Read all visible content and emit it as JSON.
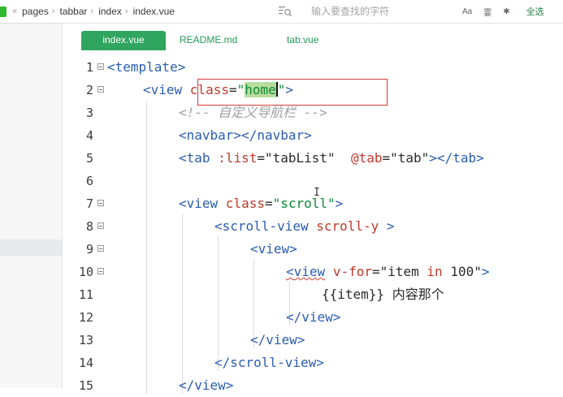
{
  "breadcrumb": {
    "items": [
      "pages",
      "tabbar",
      "index",
      "index.vue"
    ]
  },
  "search": {
    "placeholder": "输入要查找的字符"
  },
  "toolbar": {
    "case_label": "Aa",
    "word_label": "霎",
    "regex_label": "✱",
    "select_all_label": "全选"
  },
  "tabs": [
    {
      "label": "index.vue",
      "active": true
    },
    {
      "label": "README.md",
      "active": false
    },
    {
      "label": "tab.vue",
      "active": false
    }
  ],
  "colors": {
    "accent": "#2fa560",
    "tag": "#2a5db0",
    "attribute": "#c0392b",
    "string": "#0b8a37",
    "comment": "#a0a0a0",
    "highlight": "#d63a3a"
  },
  "code": {
    "line_numbers": [
      "1",
      "2",
      "3",
      "4",
      "5",
      "6",
      "7",
      "8",
      "9",
      "10",
      "11",
      "12",
      "13",
      "14",
      "15"
    ],
    "l1": {
      "tag": "<template>"
    },
    "l2": {
      "open": "<view ",
      "attr": "class",
      "eq": "=",
      "q1": "\"",
      "val": "home",
      "q2": "\"",
      "close": ">"
    },
    "l3": {
      "comment": "<!-- 自定义导航栏 -->"
    },
    "l4": {
      "tag": "<navbar></navbar>"
    },
    "l5": {
      "open": "<tab ",
      "a1": ":list",
      "eq1": "=",
      "v1": "\"tabList\"",
      "sp": "  ",
      "a2": "@tab",
      "eq2": "=",
      "v2": "\"tab\"",
      "close": "></tab>"
    },
    "l7": {
      "open": "<view ",
      "attr": "class",
      "eq": "=",
      "val": "\"scroll\"",
      "close": ">"
    },
    "l8": {
      "open": "<scroll-view ",
      "attr": "scroll-y",
      "close": " >"
    },
    "l9": {
      "tag": "<view>"
    },
    "l10": {
      "lt": "<",
      "name": "view",
      "sp": " ",
      "attr": "v-for",
      "eq": "=",
      "q1": "\"item ",
      "kw": "in",
      "q2": " 100\"",
      "close": ">"
    },
    "l11": {
      "text": "{{item}} 内容那个"
    },
    "l12": {
      "tag": "</view>"
    },
    "l13": {
      "tag": "</view>"
    },
    "l14": {
      "tag": "</scroll-view>"
    },
    "l15": {
      "tag": "</view>"
    }
  }
}
